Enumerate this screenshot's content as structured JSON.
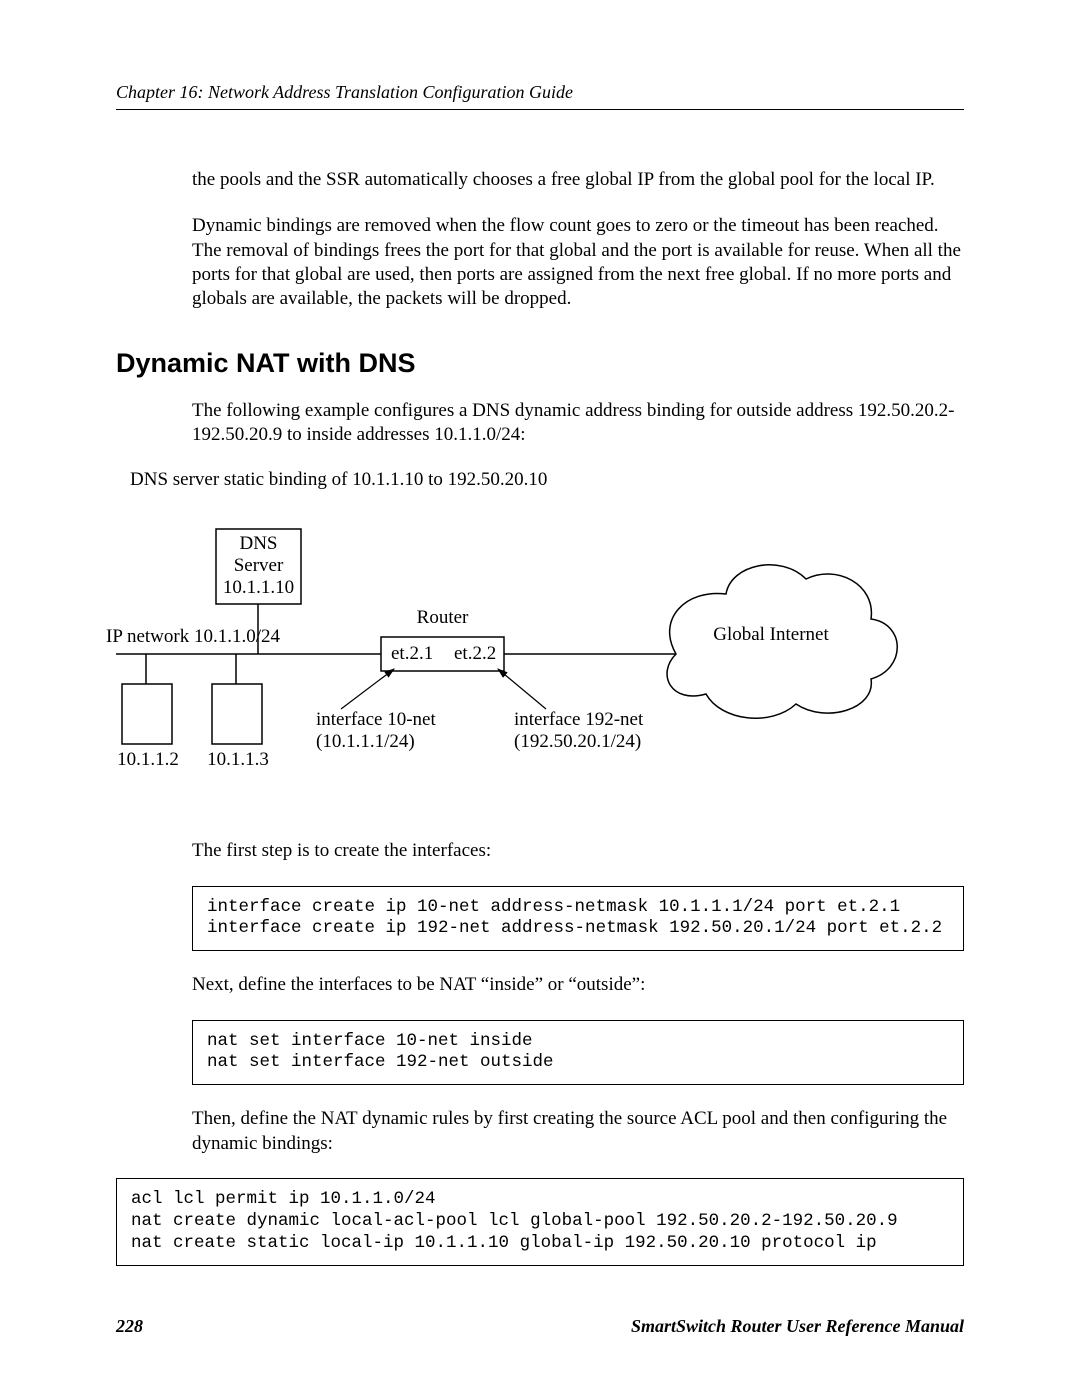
{
  "header": {
    "chapter_line": "Chapter 16: Network Address Translation Configuration Guide"
  },
  "paras": {
    "p1": "the pools and the SSR automatically chooses a free global IP from the global pool for the local IP.",
    "p2": "Dynamic bindings are removed when the flow count goes to zero or the timeout has been reached. The removal of bindings frees the port for that global and the port is available for reuse. When all the ports for that global are used, then ports are assigned from the next free global. If no more ports and globals are available, the packets will be dropped.",
    "p3": "The following example configures a DNS dynamic address binding for outside address 192.50.20.2-192.50.20.9 to inside addresses 10.1.1.0/24:",
    "p4": "The first step is to create the interfaces:",
    "p5": "Next, define the interfaces to be NAT “inside” or “outside”:",
    "p6": "Then, define the NAT dynamic rules by first creating the source ACL pool and then configuring the dynamic bindings:"
  },
  "section_heading": "Dynamic NAT with DNS",
  "diagram": {
    "caption": "DNS server static binding of 10.1.1.10 to 192.50.20.10",
    "dns_box_l1": "DNS",
    "dns_box_l2": "Server",
    "dns_box_l3": "10.1.1.10",
    "ip_network_label": "IP network 10.1.1.0/24",
    "host1": "10.1.1.2",
    "host2": "10.1.1.3",
    "router_label": "Router",
    "port_left": "et.2.1",
    "port_right": "et.2.2",
    "iface_left_l1": "interface 10-net",
    "iface_left_l2": "(10.1.1.1/24)",
    "iface_right_l1": "interface 192-net",
    "iface_right_l2": "(192.50.20.1/24)",
    "cloud_label": "Global Internet"
  },
  "code": {
    "block1": "interface create ip 10-net address-netmask 10.1.1.1/24 port et.2.1\ninterface create ip 192-net address-netmask 192.50.20.1/24 port et.2.2",
    "block2": "nat set interface 10-net inside\nnat set interface 192-net outside",
    "block3": "acl lcl permit ip 10.1.1.0/24\nnat create dynamic local-acl-pool lcl global-pool 192.50.20.2-192.50.20.9\nnat create static local-ip 10.1.1.10 global-ip 192.50.20.10 protocol ip"
  },
  "footer": {
    "page_number": "228",
    "manual_title": "SmartSwitch Router User Reference Manual"
  }
}
